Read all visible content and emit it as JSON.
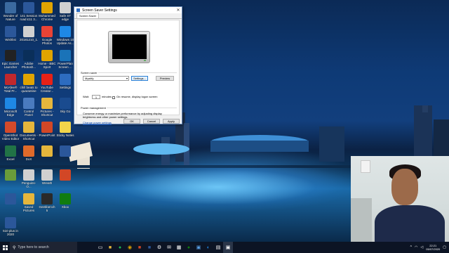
{
  "desktop": {
    "icons": [
      {
        "label": "Wonder of Nature",
        "icon": "folder-icon",
        "color": "#3b6aa0"
      },
      {
        "label": "141 Session road £11 3...",
        "icon": "word-doc-icon",
        "color": "#2b579a"
      },
      {
        "label": "Mohammed Chrome",
        "icon": "chrome-icon",
        "color": "#e0a400"
      },
      {
        "label": "Safe ST edge Shortcut",
        "icon": "document-icon",
        "color": "#d0d0d0"
      },
      {
        "label": "Wishlist",
        "icon": "word-doc-icon",
        "color": "#2b579a"
      },
      {
        "label": "20181210_1...",
        "icon": "document-icon",
        "color": "#d0d0d0"
      },
      {
        "label": "Google Photos",
        "icon": "google-photos-icon",
        "color": "#ea4335"
      },
      {
        "label": "Windows 10 Update As...",
        "icon": "windows-update-icon",
        "color": "#1e88e5"
      },
      {
        "label": "Epic Games Launcher",
        "icon": "epic-games-icon",
        "color": "#222222"
      },
      {
        "label": "Adobe Photosh...",
        "icon": "photoshop-icon",
        "color": "#0a2f5a"
      },
      {
        "label": "Home - BBC Sport",
        "icon": "chrome-icon",
        "color": "#e0a400"
      },
      {
        "label": "PowerPlan Screen ...",
        "icon": "powerplan-icon",
        "color": "#1a73b8"
      },
      {
        "label": "McAfee® Total Pr...",
        "icon": "mcafee-icon",
        "color": "#c0282d"
      },
      {
        "label": "chill beats to quarantine to",
        "icon": "chrome-icon",
        "color": "#e0a400"
      },
      {
        "label": "YouTube Creator...",
        "icon": "youtube-icon",
        "color": "#e62117"
      },
      {
        "label": "Settings",
        "icon": "settings-icon",
        "color": "#2d6cc0"
      },
      {
        "label": "Microsoft Edge",
        "icon": "edge-icon",
        "color": "#1e88e5"
      },
      {
        "label": "Control Panel",
        "icon": "control-panel-icon",
        "color": "#4a7bbf"
      },
      {
        "label": "Pictures - Shortcut",
        "icon": "folder-icon",
        "color": "#e5b63c"
      },
      {
        "label": "Sky Go",
        "icon": "sky-go-icon",
        "color": "#1a4b8f"
      },
      {
        "label": "OpenShot Video Editor",
        "icon": "openshot-icon",
        "color": "#d44a2a"
      },
      {
        "label": "Documents - Shortcut",
        "icon": "folder-icon",
        "color": "#e5b63c"
      },
      {
        "label": "PowerPoint",
        "icon": "powerpoint-icon",
        "color": "#d24726"
      },
      {
        "label": "Sticky Notes",
        "icon": "sticky-notes-icon",
        "color": "#f2d54a"
      },
      {
        "label": "Excel",
        "icon": "excel-icon",
        "color": "#217346"
      },
      {
        "label": "DoX",
        "icon": "dox-icon",
        "color": "#e06a2a"
      },
      {
        "label": "",
        "icon": "folder-icon",
        "color": "#e5b63c"
      },
      {
        "label": "",
        "icon": "word-doc-icon",
        "color": "#2b579a"
      },
      {
        "label": "",
        "icon": "minecraft-icon",
        "color": "#6a9c3a"
      },
      {
        "label": "Penguins-O...",
        "icon": "document-icon",
        "color": "#d0d0d0"
      },
      {
        "label": "Wreath",
        "icon": "document-icon",
        "color": "#d0d0d0"
      },
      {
        "label": "",
        "icon": "powerpoint-icon",
        "color": "#d24726"
      },
      {
        "label": "",
        "icon": "word-doc-icon",
        "color": "#2b579a"
      },
      {
        "label": "Saved Pictures",
        "icon": "folder-icon",
        "color": "#e5b63c"
      },
      {
        "label": "Geekbench 5",
        "icon": "geekbench-icon",
        "color": "#2a2a2a"
      },
      {
        "label": "Xbox",
        "icon": "xbox-icon",
        "color": "#107c10"
      },
      {
        "label": "510 plus in 2020",
        "icon": "word-doc-icon",
        "color": "#2b579a"
      }
    ]
  },
  "dialog": {
    "title": "Screen Saver Settings",
    "tab": "Screen Saver",
    "screen_saver_group": "Screen saver",
    "selected_saver": "Mystify",
    "settings_button": "Settings...",
    "preview_button": "Preview",
    "wait_label": "Wait:",
    "wait_value": "1",
    "minutes_label": "minutes",
    "resume_label": "On resume, display logon screen",
    "power_group": "Power management",
    "power_desc": "Conserve energy or maximize performance by adjusting display brightness and other power settings.",
    "power_link": "Change power settings",
    "ok": "OK",
    "cancel": "Cancel",
    "apply": "Apply"
  },
  "taskbar": {
    "search_placeholder": "Type here to search",
    "time": "22:21",
    "date": "05/07/2020"
  }
}
